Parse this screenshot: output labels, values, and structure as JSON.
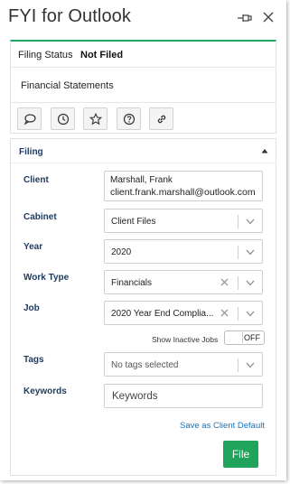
{
  "app": {
    "title": "FYI for Outlook"
  },
  "status": {
    "label": "Filing Status",
    "value": "Not Filed",
    "document_title": "Financial Statements"
  },
  "actions": [
    {
      "icon": "comment-icon"
    },
    {
      "icon": "clock-icon"
    },
    {
      "icon": "star-icon"
    },
    {
      "icon": "help-icon"
    },
    {
      "icon": "link-icon"
    }
  ],
  "filing": {
    "title": "Filing",
    "client": {
      "label": "Client",
      "name": "Marshall, Frank",
      "email": "client.frank.marshall@outlook.com"
    },
    "cabinet": {
      "label": "Cabinet",
      "value": "Client Files"
    },
    "year": {
      "label": "Year",
      "value": "2020"
    },
    "work_type": {
      "label": "Work Type",
      "value": "Financials"
    },
    "job": {
      "label": "Job",
      "value": "2020 Year End Complia..."
    },
    "inactive_jobs": {
      "label": "Show Inactive Jobs",
      "state": "OFF"
    },
    "tags": {
      "label": "Tags",
      "placeholder": "No tags selected"
    },
    "keywords": {
      "label": "Keywords",
      "placeholder": "Keywords"
    },
    "save_default_label": "Save as Client Default",
    "file_button_label": "File"
  },
  "colors": {
    "accent_green": "#22a866",
    "file_button": "#20a35a",
    "link_blue": "#1a73b8",
    "label_navy": "#1e3a5f"
  }
}
